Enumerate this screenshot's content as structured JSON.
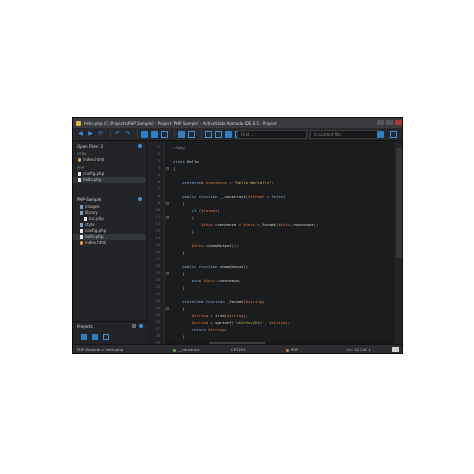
{
  "window": {
    "title": "hello.php (C:\\Projects\\PHP Sample) - Project 'PHP Sample' - ActiveState Komodo IDE 8.5 - Project"
  },
  "toolbar": {
    "find_placeholder": "Find ...",
    "scope_label": "in current file",
    "icons": [
      "back-icon",
      "forward-icon",
      "recent-icon",
      "undo-icon",
      "redo-icon",
      "open-file-icon",
      "save-icon",
      "save-all-icon",
      "new-file-icon",
      "panes-left-icon",
      "panes-bottom-icon",
      "panes-right-icon",
      "layout-icon",
      "toolbox-icon",
      "macro-icon"
    ]
  },
  "sidebar": {
    "open_files": {
      "label": "Open Files: 3",
      "groups": [
        {
          "label": "HTML",
          "files": [
            "index.html"
          ]
        },
        {
          "label": "PHP",
          "files": [
            "config.php",
            "hello.php"
          ]
        }
      ]
    },
    "project": {
      "label": "PHP-Sample",
      "items": [
        {
          "label": "images",
          "type": "folder",
          "indent": 1
        },
        {
          "label": "library",
          "type": "folder",
          "indent": 1
        },
        {
          "label": "inc.php",
          "type": "php",
          "indent": 2
        },
        {
          "label": "style",
          "type": "folder",
          "indent": 1
        },
        {
          "label": "config.php",
          "type": "php",
          "indent": 1
        },
        {
          "label": "hello.php",
          "type": "php",
          "indent": 1,
          "selected": true
        },
        {
          "label": "index.html",
          "type": "html",
          "indent": 1
        }
      ]
    },
    "projects_panel": {
      "label": "Projects"
    }
  },
  "editor": {
    "line_numbers": [
      "1",
      "2",
      "3",
      "4",
      "5",
      "6",
      "7",
      "8",
      "9",
      "10",
      "11",
      "12",
      "13",
      "14",
      "15",
      "16",
      "17",
      "18",
      "19",
      "20",
      "21",
      "22",
      "23",
      "24",
      "25",
      "26",
      "27",
      "28",
      "29"
    ],
    "lines": [
      [
        [
          "c-tag",
          "<?php"
        ]
      ],
      [
        [
          "c-op",
          ""
        ]
      ],
      [
        [
          "c-kw",
          "class"
        ],
        [
          "c-fn",
          " Hello"
        ]
      ],
      [
        [
          "c-op",
          "{"
        ]
      ],
      [
        [
          "c-op",
          ""
        ]
      ],
      [
        [
          "c-kw",
          "    protected"
        ],
        [
          "c-var",
          " $sentence"
        ],
        [
          "c-op",
          " = "
        ],
        [
          "c-str",
          "\"Hello World!\\n\""
        ],
        [
          "c-op",
          ";"
        ]
      ],
      [
        [
          "c-op",
          ""
        ]
      ],
      [
        [
          "c-kw",
          "    public function"
        ],
        [
          "c-fn",
          " __construct"
        ],
        [
          "c-op",
          "("
        ],
        [
          "c-var",
          "$format"
        ],
        [
          "c-op",
          " = "
        ],
        [
          "c-kw",
          "false"
        ],
        [
          "c-op",
          ")"
        ]
      ],
      [
        [
          "c-op",
          "    {"
        ]
      ],
      [
        [
          "c-kw",
          "        if"
        ],
        [
          "c-op",
          " ("
        ],
        [
          "c-var",
          "$format"
        ],
        [
          "c-op",
          ")"
        ]
      ],
      [
        [
          "c-op",
          "        {"
        ]
      ],
      [
        [
          "c-var",
          "            $this"
        ],
        [
          "c-op",
          "->"
        ],
        [
          "c-fn",
          "sentence"
        ],
        [
          "c-op",
          " = "
        ],
        [
          "c-var",
          "$this"
        ],
        [
          "c-op",
          "->"
        ],
        [
          "c-fn",
          "_format"
        ],
        [
          "c-op",
          "("
        ],
        [
          "c-var",
          "$this"
        ],
        [
          "c-op",
          "->"
        ],
        [
          "c-fn",
          "sentence"
        ],
        [
          "c-op",
          ");"
        ]
      ],
      [
        [
          "c-op",
          "        }"
        ]
      ],
      [
        [
          "c-op",
          ""
        ]
      ],
      [
        [
          "c-var",
          "        $this"
        ],
        [
          "c-op",
          "->"
        ],
        [
          "c-fn",
          "showOutput"
        ],
        [
          "c-op",
          "();"
        ]
      ],
      [
        [
          "c-op",
          "    }"
        ]
      ],
      [
        [
          "c-op",
          ""
        ]
      ],
      [
        [
          "c-kw",
          "    public function"
        ],
        [
          "c-fn",
          " showOutput"
        ],
        [
          "c-op",
          "()"
        ]
      ],
      [
        [
          "c-op",
          "    {"
        ]
      ],
      [
        [
          "c-kw",
          "        echo"
        ],
        [
          "c-var",
          " $this"
        ],
        [
          "c-op",
          "->"
        ],
        [
          "c-fn",
          "sentence"
        ],
        [
          "c-op",
          ";"
        ]
      ],
      [
        [
          "c-op",
          "    }"
        ]
      ],
      [
        [
          "c-op",
          ""
        ]
      ],
      [
        [
          "c-kw",
          "    protected function"
        ],
        [
          "c-fn",
          " _format"
        ],
        [
          "c-op",
          "("
        ],
        [
          "c-var",
          "$string"
        ],
        [
          "c-op",
          ")"
        ]
      ],
      [
        [
          "c-op",
          "    {"
        ]
      ],
      [
        [
          "c-var",
          "        $string"
        ],
        [
          "c-op",
          " = "
        ],
        [
          "c-fn",
          "trim"
        ],
        [
          "c-op",
          "("
        ],
        [
          "c-var",
          "$string"
        ],
        [
          "c-op",
          ");"
        ]
      ],
      [
        [
          "c-var",
          "        $string"
        ],
        [
          "c-op",
          " = "
        ],
        [
          "c-fn",
          "sprintf"
        ],
        [
          "c-op",
          "("
        ],
        [
          "c-str",
          "'<h1>%s</h1>'"
        ],
        [
          "c-op",
          ", "
        ],
        [
          "c-var",
          "$string"
        ],
        [
          "c-op",
          ");"
        ]
      ],
      [
        [
          "c-kw",
          "        return"
        ],
        [
          "c-var",
          " $string"
        ],
        [
          "c-op",
          ";"
        ]
      ],
      [
        [
          "c-op",
          "    }"
        ]
      ],
      [
        [
          "c-op",
          ""
        ]
      ]
    ]
  },
  "statusbar": {
    "breadcrumb": "PHP-Sample > hello.php",
    "symbol": "__construct",
    "encoding": "CP1252",
    "language": "PHP",
    "position": "Ln: 14 Col: 1"
  },
  "colors": {
    "accent": "#2f7fc6",
    "background": "#1e1f21",
    "variable": "#e07a4a",
    "string": "#d6c26a",
    "keyword": "#8fa8d0"
  }
}
